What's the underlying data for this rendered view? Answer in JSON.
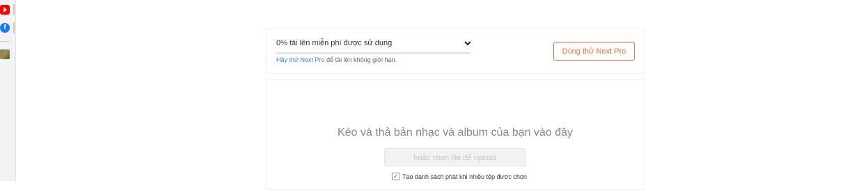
{
  "sidebar": {
    "icons": [
      "youtube-icon",
      "facebook-icon",
      "avatar-thumbnail"
    ]
  },
  "quota": {
    "title": "0% tải lên miễn phí được sử dụng",
    "progress_percent": 0,
    "hint_link": "Hãy thử Next Pro",
    "hint_rest": " để tải lên không giới hạn.",
    "try_button": "Dùng thử Next Pro",
    "accent_color": "#e8733a"
  },
  "upload": {
    "title": "Kéo và thả bản nhạc và album của bạn vào đây",
    "choose_button": "hoặc chọn file để upload",
    "playlist_checkbox_label": "Tạo danh sách phát khi nhiều tệp được chọn",
    "playlist_checked": true
  }
}
